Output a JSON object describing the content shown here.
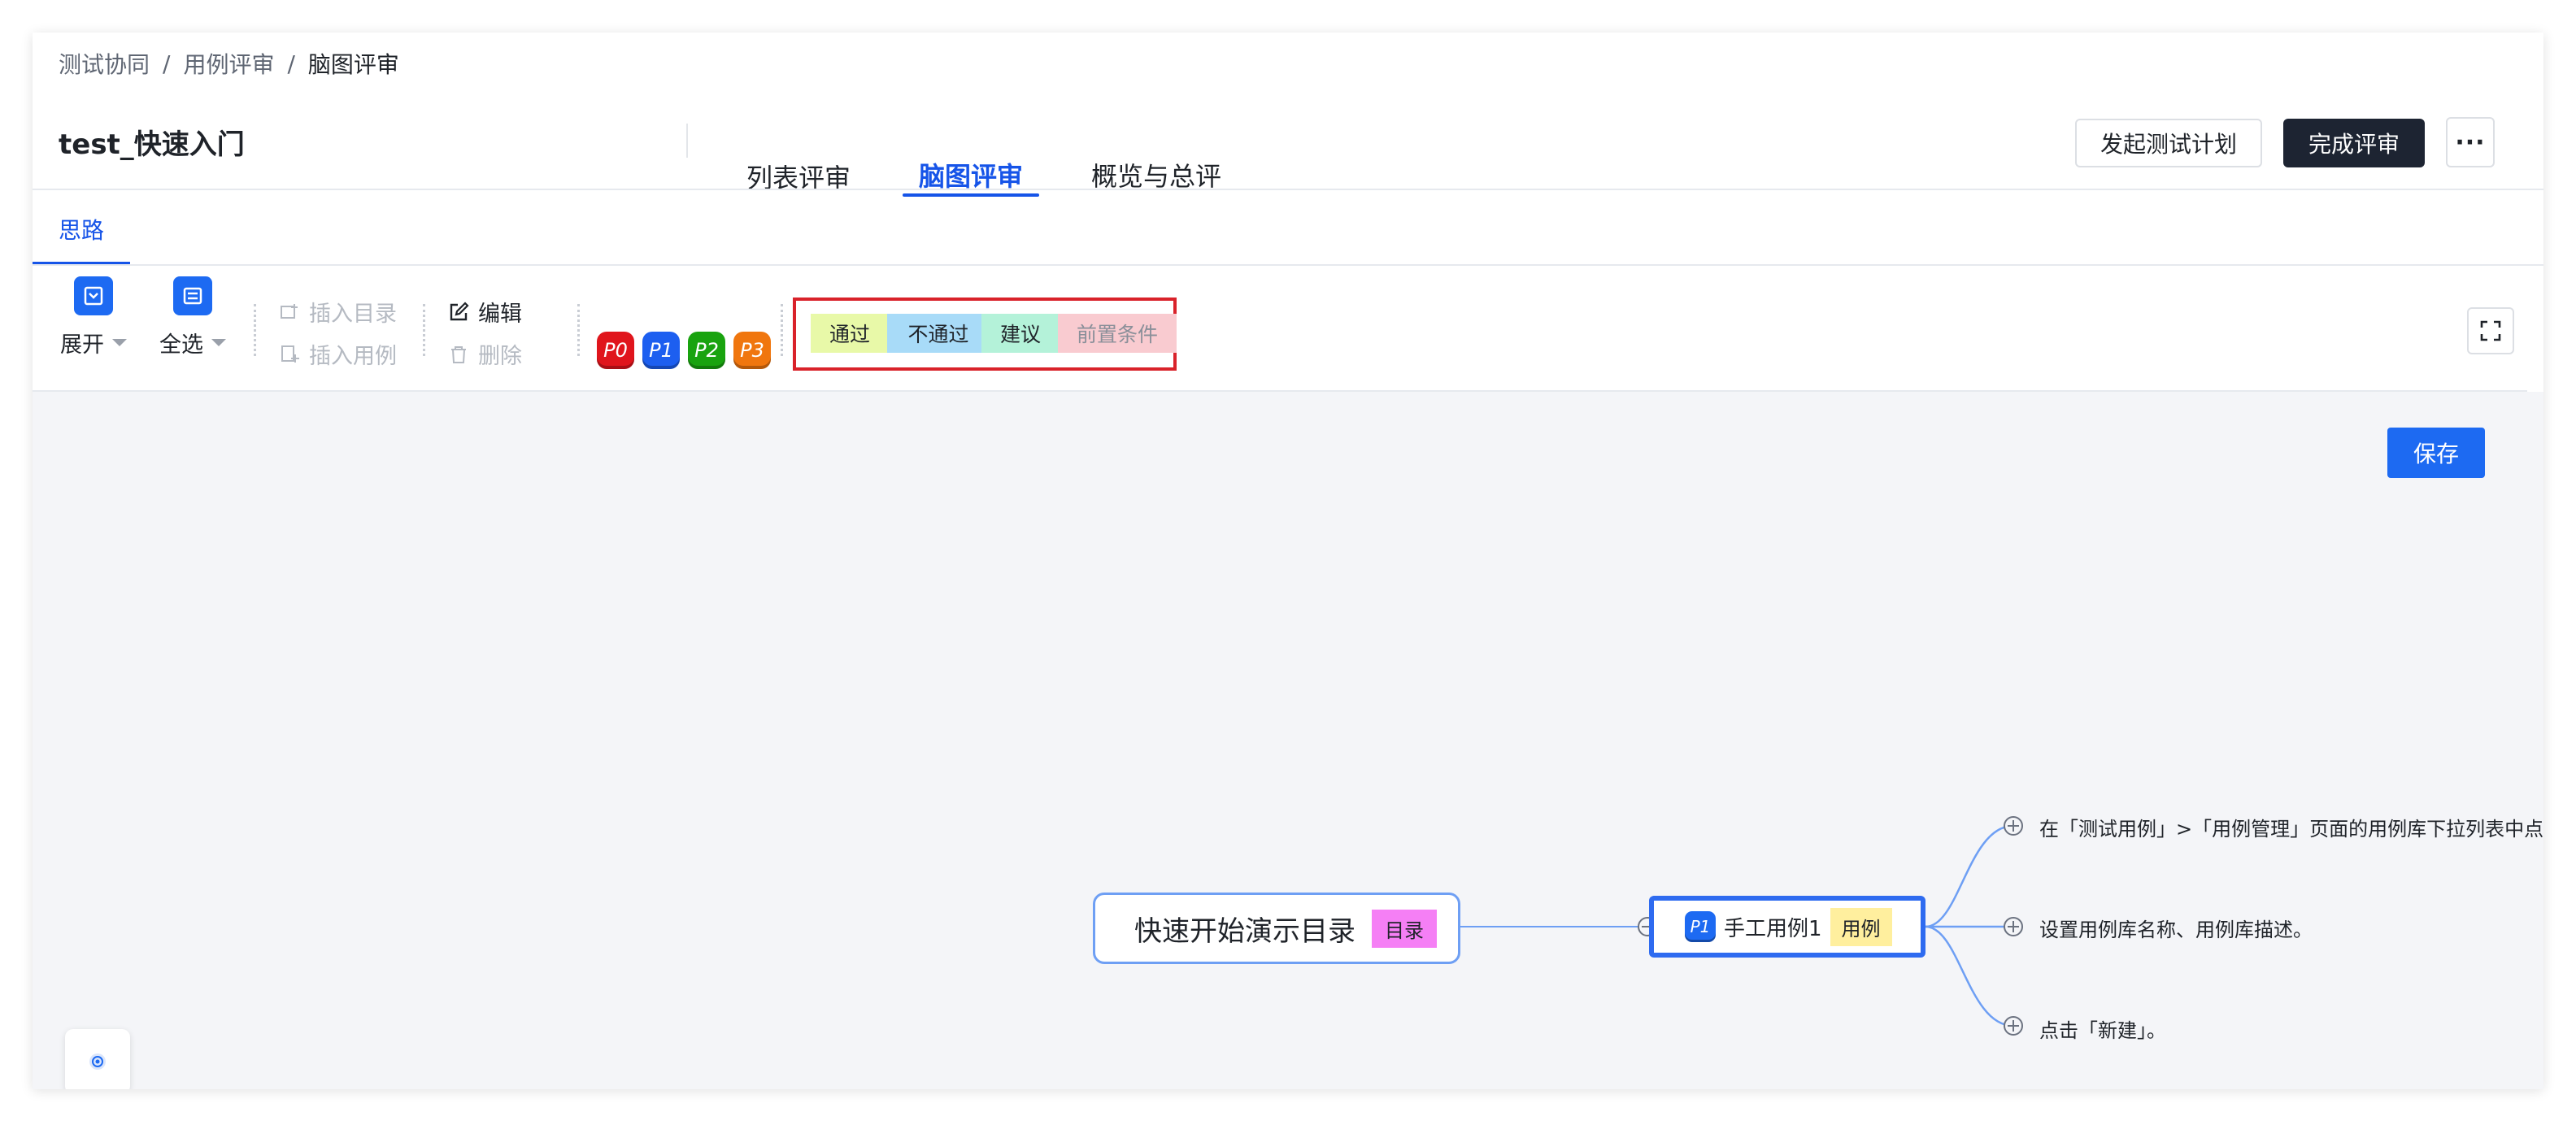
{
  "breadcrumb": {
    "items": [
      "测试协同",
      "用例评审",
      "脑图评审"
    ],
    "separator": "/"
  },
  "header": {
    "title": "test_快速入门",
    "tabs": [
      {
        "label": "列表评审"
      },
      {
        "label": "脑图评审"
      },
      {
        "label": "概览与总评"
      }
    ],
    "active_tab": "脑图评审",
    "start_plan_label": "发起测试计划",
    "complete_review_label": "完成评审",
    "more_label": "···"
  },
  "subtab": {
    "label": "思路"
  },
  "toolbar": {
    "expand_label": "展开",
    "select_all_label": "全选",
    "insert_dir_label": "插入目录",
    "insert_case_label": "插入用例",
    "edit_label": "编辑",
    "delete_label": "删除",
    "priorities": [
      {
        "label": "P0",
        "color": "#e0151c"
      },
      {
        "label": "P1",
        "color": "#1d5ff0"
      },
      {
        "label": "P2",
        "color": "#19a30f"
      },
      {
        "label": "P3",
        "color": "#f0760e"
      }
    ],
    "review_tags": [
      {
        "label": "通过",
        "color": "#e8f9a8"
      },
      {
        "label": "不通过",
        "color": "#a8dbf8"
      },
      {
        "label": "建议",
        "color": "#b4f2d9"
      },
      {
        "label": "前置条件",
        "color": "#f9cbd0"
      }
    ]
  },
  "canvas": {
    "save_label": "保存",
    "root_node": {
      "text": "快速开始演示目录",
      "tag": "目录"
    },
    "case_node": {
      "priority": "P1",
      "text": "手工用例1",
      "tag": "用例"
    },
    "steps": [
      "在「测试用例」>「用例管理」页面的用例库下拉列表中点击",
      "设置用例库名称、用例库描述。",
      "点击「新建」。"
    ]
  },
  "colors": {
    "accent": "#1654e8",
    "dark_button": "#1d2432",
    "highlight_border": "#d9222a"
  }
}
